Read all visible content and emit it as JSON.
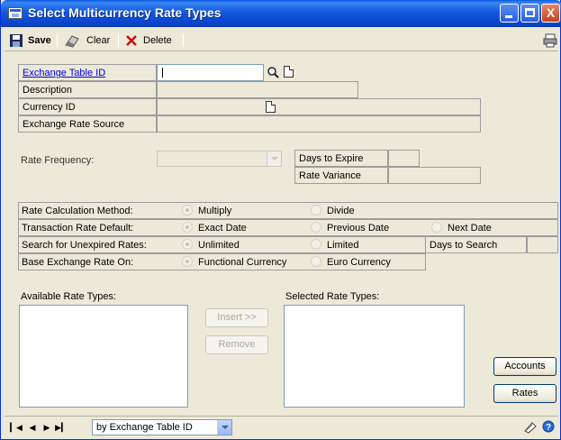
{
  "window": {
    "title": "Select Multicurrency Rate Types",
    "minimize_label": "_",
    "close_label": "X"
  },
  "toolbar": {
    "save_label": "Save",
    "clear_label": "Clear",
    "delete_label": "Delete"
  },
  "form": {
    "exchange_table_id_label": "Exchange Table ID",
    "exchange_table_id_value": "",
    "description_label": "Description",
    "currency_id_label": "Currency ID",
    "exchange_rate_source_label": "Exchange Rate Source",
    "rate_frequency_label": "Rate Frequency:",
    "days_to_expire_label": "Days to Expire",
    "rate_variance_label": "Rate Variance"
  },
  "options": {
    "rate_calc_label": "Rate Calculation Method:",
    "rate_calc_opt1": "Multiply",
    "rate_calc_opt2": "Divide",
    "trx_default_label": "Transaction Rate Default:",
    "trx_opt1": "Exact Date",
    "trx_opt2": "Previous Date",
    "trx_opt3": "Next Date",
    "search_label": "Search for Unexpired Rates:",
    "search_opt1": "Unlimited",
    "search_opt2": "Limited",
    "days_to_search_label": "Days to Search",
    "base_label": "Base Exchange Rate On:",
    "base_opt1": "Functional Currency",
    "base_opt2": "Euro Currency"
  },
  "rate_types": {
    "available_label": "Available Rate Types:",
    "selected_label": "Selected Rate Types:",
    "insert_label": "Insert >>",
    "remove_label": "Remove",
    "accounts_label": "Accounts",
    "rates_label": "Rates"
  },
  "status_bar": {
    "browse_by_value": "by Exchange Table ID"
  },
  "colors": {
    "title_bar": "#0a48d0",
    "window_bg": "#ece9d8",
    "link": "#0000ee"
  },
  "icons": {
    "window": "window-icon",
    "save": "floppy-disk-icon",
    "clear": "eraser-icon",
    "delete": "red-x-icon",
    "print": "printer-icon",
    "lookup": "magnifier-icon",
    "new": "new-document-icon",
    "note": "note-icon",
    "help": "help-icon"
  }
}
